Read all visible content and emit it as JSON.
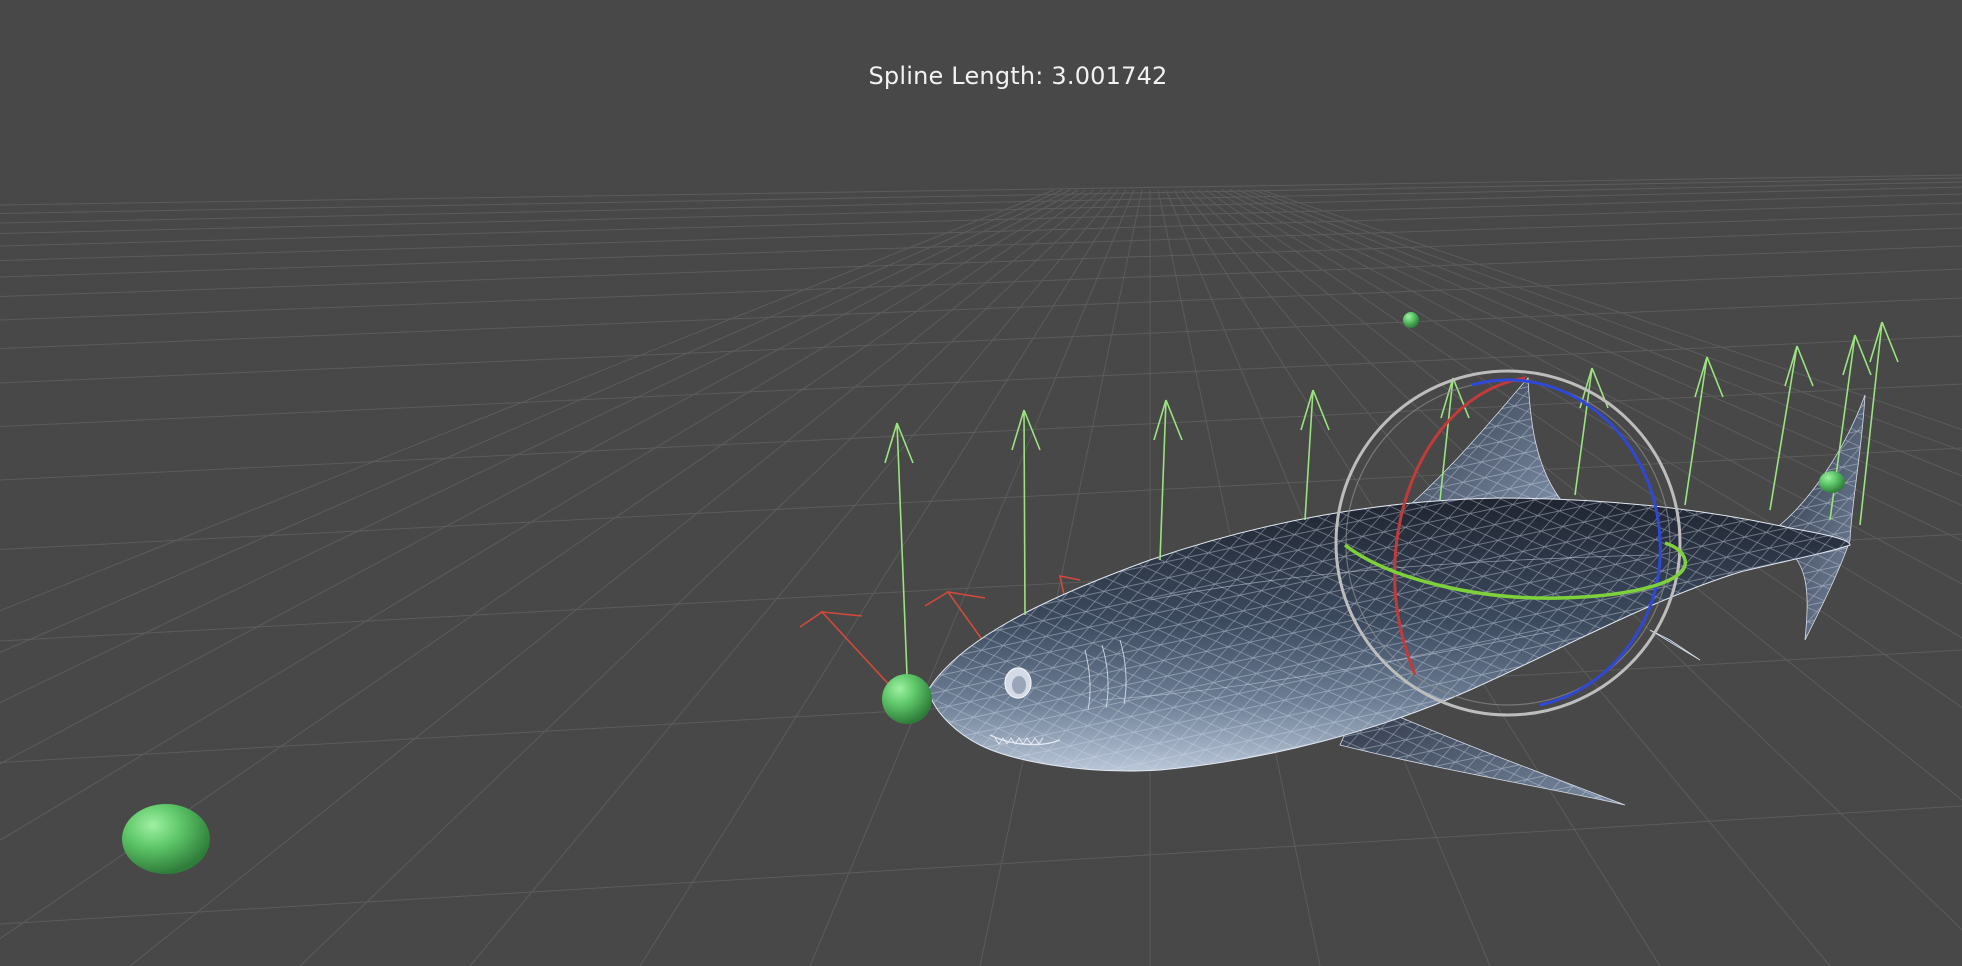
{
  "overlay": {
    "spline_length_text": "Spline Length: 3.001742"
  },
  "scene": {
    "background_color": "#484848",
    "grid_color": "#5c5c5c",
    "spline_point_color": "#5fc86a",
    "up_vector_color": "#9be37e",
    "forward_vector_color": "#d24a3a",
    "rotation_gizmo": {
      "x_axis_color": "#c23a3a",
      "y_axis_color": "#7fd13b",
      "z_axis_color": "#2f48d8",
      "outer_ring_color": "#bdbdbd"
    },
    "model": "shark-wireframe"
  }
}
